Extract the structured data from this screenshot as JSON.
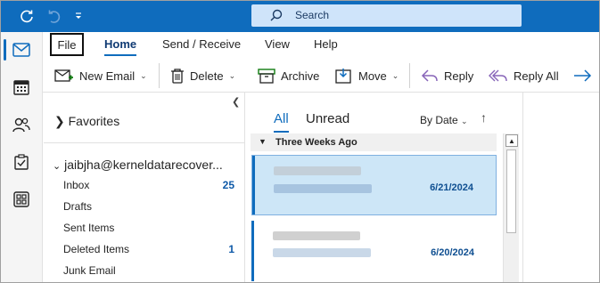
{
  "titlebar": {
    "icons": [
      "sync-icon",
      "undo-icon",
      "customize-qat-icon"
    ],
    "search": {
      "placeholder": "Search"
    }
  },
  "rail": {
    "items": [
      "mail-icon",
      "calendar-icon",
      "people-icon",
      "tasks-icon",
      "apps-icon"
    ],
    "active": "mail-icon"
  },
  "ribbon": {
    "tabs": [
      "File",
      "Home",
      "Send / Receive",
      "View",
      "Help"
    ],
    "active_tab": "Home",
    "buttons": {
      "new_email": "New Email",
      "delete": "Delete",
      "archive": "Archive",
      "move": "Move",
      "reply": "Reply",
      "reply_all": "Reply All"
    }
  },
  "folders": {
    "favorites": "Favorites",
    "account": "jaibjha@kerneldatarecover...",
    "items": [
      {
        "label": "Inbox",
        "count": "25"
      },
      {
        "label": "Drafts",
        "count": ""
      },
      {
        "label": "Sent Items",
        "count": ""
      },
      {
        "label": "Deleted Items",
        "count": "1"
      },
      {
        "label": "Junk Email",
        "count": ""
      }
    ]
  },
  "messages": {
    "filters": {
      "all": "All",
      "unread": "Unread"
    },
    "sort": "By Date",
    "group": "Three Weeks Ago",
    "items": [
      {
        "date": "6/21/2024",
        "selected": true
      },
      {
        "date": "6/20/2024",
        "selected": false
      }
    ]
  },
  "colors": {
    "accent": "#0f6cbd",
    "selected_row": "#cde6f7",
    "search_box": "#cfe4fa"
  }
}
